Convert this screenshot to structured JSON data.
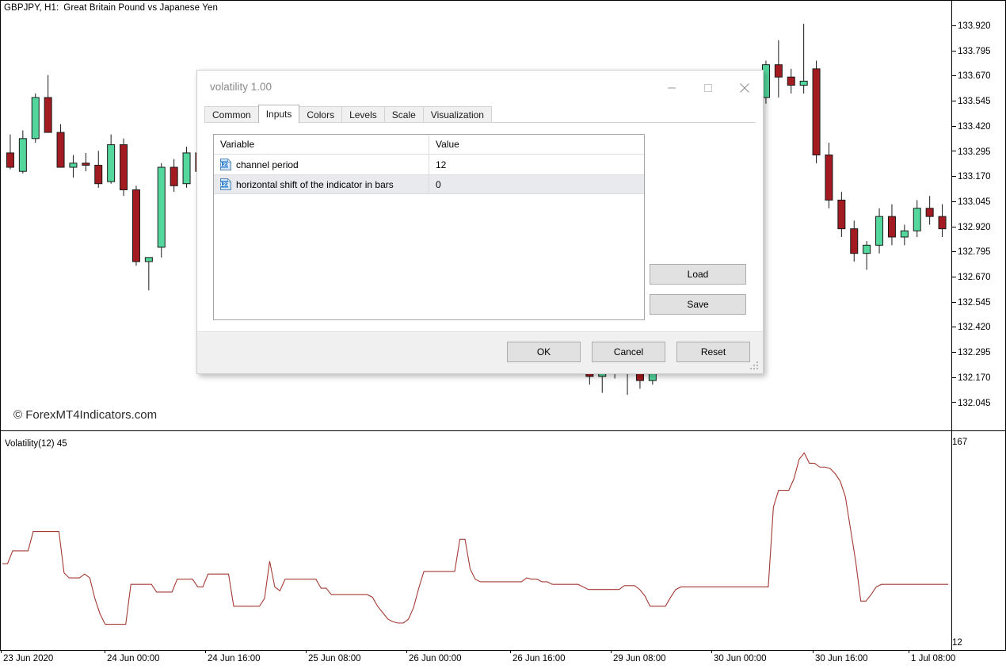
{
  "chart": {
    "symbol": "GBPJPY, H1:",
    "description": "Great Britain Pound vs Japanese Yen",
    "watermark": "© ForexMT4Indicators.com",
    "price_scale": [
      "133.920",
      "133.795",
      "133.670",
      "133.545",
      "133.420",
      "133.295",
      "133.170",
      "133.045",
      "132.920",
      "132.795",
      "132.670",
      "132.545",
      "132.420",
      "132.295",
      "132.170",
      "132.045"
    ],
    "time_labels": [
      "23 Jun 2020",
      "24 Jun 00:00",
      "24 Jun 16:00",
      "25 Jun 08:00",
      "26 Jun 00:00",
      "26 Jun 16:00",
      "29 Jun 08:00",
      "30 Jun 00:00",
      "30 Jun 16:00",
      "1 Jul 08:00"
    ],
    "indicator_label": "Volatility(12) 45",
    "indicator_scale_top": "167",
    "indicator_scale_bottom": "12",
    "colors": {
      "bull": "#53D79C",
      "bear": "#A31A20",
      "outline": "#1a1a1a",
      "indicator_line": "#A33A33",
      "axis": "#000000"
    }
  },
  "dialog": {
    "title": "volatility 1.00",
    "window_buttons": [
      {
        "name": "minimize-button",
        "icon": "minimize-icon"
      },
      {
        "name": "maximize-button",
        "icon": "maximize-icon"
      },
      {
        "name": "close-button",
        "icon": "close-icon"
      }
    ],
    "tabs": [
      {
        "label": "Common",
        "active": false
      },
      {
        "label": "Inputs",
        "active": true
      },
      {
        "label": "Colors",
        "active": false
      },
      {
        "label": "Levels",
        "active": false
      },
      {
        "label": "Scale",
        "active": false
      },
      {
        "label": "Visualization",
        "active": false
      }
    ],
    "table": {
      "headers": [
        "Variable",
        "Value"
      ],
      "rows": [
        {
          "icon": "123-number-icon",
          "variable": "channel period",
          "value": "12"
        },
        {
          "icon": "123-number-icon",
          "variable": "horizontal shift of the indicator in bars",
          "value": "0"
        }
      ]
    },
    "side_buttons": [
      {
        "label": "Load",
        "name": "load-button"
      },
      {
        "label": "Save",
        "name": "save-button"
      }
    ],
    "footer_buttons": [
      {
        "label": "OK",
        "name": "ok-button"
      },
      {
        "label": "Cancel",
        "name": "cancel-button"
      },
      {
        "label": "Reset",
        "name": "reset-button"
      }
    ]
  },
  "chart_data": {
    "type": "line",
    "title": "Volatility(12) 45",
    "xlabel": "",
    "ylabel": "",
    "ylim": [
      12,
      167
    ],
    "grid": false,
    "legend": "none",
    "x_tick_labels": [
      "23 Jun 2020",
      "24 Jun 00:00",
      "24 Jun 16:00",
      "25 Jun 08:00",
      "26 Jun 00:00",
      "26 Jun 16:00",
      "29 Jun 08:00",
      "30 Jun 00:00",
      "30 Jun 16:00",
      "1 Jul 08:00"
    ],
    "series": [
      {
        "name": "Volatility(12)",
        "color": "#A33A33",
        "values": [
          74,
          74,
          84,
          84,
          84,
          84,
          99,
          99,
          99,
          99,
          99,
          99,
          67,
          63,
          63,
          63,
          66,
          63,
          47,
          35,
          27,
          27,
          27,
          27,
          27,
          58,
          58,
          58,
          58,
          58,
          52,
          52,
          52,
          52,
          62,
          62,
          62,
          62,
          56,
          56,
          66,
          66,
          66,
          66,
          66,
          41,
          41,
          41,
          41,
          41,
          41,
          47,
          76,
          56,
          53,
          62,
          62,
          62,
          62,
          62,
          62,
          62,
          55,
          55,
          50,
          50,
          50,
          50,
          50,
          50,
          50,
          50,
          48,
          41,
          36,
          31,
          29,
          28,
          28,
          31,
          40,
          55,
          68,
          68,
          68,
          68,
          68,
          68,
          68,
          93,
          93,
          70,
          62,
          60,
          60,
          60,
          60,
          60,
          60,
          60,
          60,
          60,
          63,
          62,
          62,
          60,
          60,
          58,
          58,
          58,
          58,
          58,
          58,
          56,
          54,
          54,
          54,
          54,
          54,
          54,
          54,
          57,
          57,
          57,
          54,
          49,
          41,
          41,
          41,
          41,
          48,
          54,
          56,
          56,
          56,
          56,
          56,
          56,
          56,
          56,
          56,
          56,
          56,
          56,
          56,
          56,
          56,
          56,
          56,
          56,
          118,
          131,
          131,
          131,
          140,
          155,
          160,
          152,
          152,
          149,
          149,
          148,
          144,
          138,
          126,
          101,
          76,
          45,
          45,
          50,
          56,
          58,
          58,
          58,
          58,
          58,
          58,
          58,
          58,
          58,
          58,
          58,
          58,
          58,
          58
        ]
      }
    ]
  },
  "price_chart_data": {
    "type": "candlestick",
    "symbol": "GBPJPY",
    "timeframe": "H1",
    "y_tick_labels": [
      "133.920",
      "133.795",
      "133.670",
      "133.545",
      "133.420",
      "133.295",
      "133.170",
      "133.045",
      "132.920",
      "132.795",
      "132.670",
      "132.545",
      "132.420",
      "132.295",
      "132.170",
      "132.045"
    ],
    "ylim": [
      131.98,
      133.99
    ],
    "candles": [
      {
        "o": 133.31,
        "h": 133.4,
        "l": 133.23,
        "c": 133.24
      },
      {
        "o": 133.22,
        "h": 133.42,
        "l": 133.21,
        "c": 133.38
      },
      {
        "o": 133.38,
        "h": 133.6,
        "l": 133.36,
        "c": 133.58
      },
      {
        "o": 133.58,
        "h": 133.69,
        "l": 133.5,
        "c": 133.41
      },
      {
        "o": 133.41,
        "h": 133.45,
        "l": 133.31,
        "c": 133.24
      },
      {
        "o": 133.24,
        "h": 133.3,
        "l": 133.19,
        "c": 133.26
      },
      {
        "o": 133.26,
        "h": 133.31,
        "l": 133.22,
        "c": 133.25
      },
      {
        "o": 133.25,
        "h": 133.32,
        "l": 133.14,
        "c": 133.16
      },
      {
        "o": 133.17,
        "h": 133.4,
        "l": 133.16,
        "c": 133.35
      },
      {
        "o": 133.35,
        "h": 133.38,
        "l": 133.1,
        "c": 133.13
      },
      {
        "o": 133.13,
        "h": 133.15,
        "l": 132.76,
        "c": 132.78
      },
      {
        "o": 132.78,
        "h": 132.79,
        "l": 132.64,
        "c": 132.8
      },
      {
        "o": 132.85,
        "h": 133.26,
        "l": 132.8,
        "c": 133.24
      },
      {
        "o": 133.24,
        "h": 133.28,
        "l": 133.12,
        "c": 133.15
      },
      {
        "o": 133.16,
        "h": 133.34,
        "l": 133.14,
        "c": 133.31
      },
      {
        "o": 133.31,
        "h": 133.36,
        "l": 133.2,
        "c": 133.22
      },
      {
        "o": 133.22,
        "h": 133.26,
        "l": 133.17,
        "c": 133.24
      },
      {
        "o": 133.24,
        "h": 133.28,
        "l": 133.13,
        "c": 133.17
      },
      {
        "o": 133.17,
        "h": 133.3,
        "l": 133.16,
        "c": 133.28
      },
      {
        "o": 133.28,
        "h": 133.3,
        "l": 133.13,
        "c": 133.15
      },
      {
        "o": 133.15,
        "h": 133.22,
        "l": 133.13,
        "c": 133.2
      },
      {
        "o": 133.2,
        "h": 133.26,
        "l": 133.18,
        "c": 133.22
      },
      {
        "o": 133.22,
        "h": 133.56,
        "l": 133.2,
        "c": 133.53
      },
      {
        "o": 133.53,
        "h": 133.57,
        "l": 133.3,
        "c": 133.35
      },
      {
        "o": 133.35,
        "h": 133.38,
        "l": 133.25,
        "c": 133.27
      },
      {
        "o": 133.27,
        "h": 133.3,
        "l": 133.18,
        "c": 133.21
      },
      {
        "o": 133.21,
        "h": 133.34,
        "l": 133.16,
        "c": 133.24
      },
      {
        "o": 133.24,
        "h": 133.27,
        "l": 133.14,
        "c": 133.2
      },
      {
        "o": 133.22,
        "h": 133.36,
        "l": 133.17,
        "c": 133.33
      },
      {
        "o": 133.33,
        "h": 133.54,
        "l": 132.89,
        "c": 132.96
      },
      {
        "o": 132.96,
        "h": 133.0,
        "l": 132.86,
        "c": 132.93
      },
      {
        "o": 132.93,
        "h": 133.32,
        "l": 132.74,
        "c": 133.27
      },
      {
        "o": 133.27,
        "h": 133.32,
        "l": 133.07,
        "c": 133.11
      },
      {
        "o": 133.11,
        "h": 133.17,
        "l": 133.08,
        "c": 133.13
      },
      {
        "o": 133.13,
        "h": 133.18,
        "l": 133.01,
        "c": 133.05
      },
      {
        "o": 133.05,
        "h": 133.1,
        "l": 132.95,
        "c": 133.0
      },
      {
        "o": 133.0,
        "h": 133.05,
        "l": 132.9,
        "c": 132.95
      },
      {
        "o": 132.95,
        "h": 133.02,
        "l": 132.88,
        "c": 132.98
      },
      {
        "o": 132.98,
        "h": 133.03,
        "l": 132.85,
        "c": 132.9
      },
      {
        "o": 132.9,
        "h": 132.96,
        "l": 132.83,
        "c": 132.92
      },
      {
        "o": 132.92,
        "h": 132.98,
        "l": 132.82,
        "c": 132.87
      },
      {
        "o": 132.87,
        "h": 132.94,
        "l": 132.8,
        "c": 132.9
      },
      {
        "o": 132.9,
        "h": 132.95,
        "l": 132.78,
        "c": 132.82
      },
      {
        "o": 132.82,
        "h": 132.9,
        "l": 132.76,
        "c": 132.86
      },
      {
        "o": 132.86,
        "h": 132.92,
        "l": 132.74,
        "c": 132.8
      },
      {
        "o": 132.8,
        "h": 132.88,
        "l": 132.72,
        "c": 132.84
      },
      {
        "o": 132.28,
        "h": 132.46,
        "l": 132.18,
        "c": 132.22
      },
      {
        "o": 132.22,
        "h": 132.3,
        "l": 132.14,
        "c": 132.28
      },
      {
        "o": 132.28,
        "h": 132.36,
        "l": 132.21,
        "c": 132.24
      },
      {
        "o": 132.24,
        "h": 132.31,
        "l": 132.13,
        "c": 132.27
      },
      {
        "o": 132.27,
        "h": 132.3,
        "l": 132.16,
        "c": 132.2
      },
      {
        "o": 132.2,
        "h": 132.28,
        "l": 132.18,
        "c": 132.26
      },
      {
        "o": 132.26,
        "h": 132.45,
        "l": 132.24,
        "c": 132.42
      },
      {
        "o": 132.42,
        "h": 132.62,
        "l": 132.38,
        "c": 132.58
      },
      {
        "o": 132.58,
        "h": 133.1,
        "l": 132.55,
        "c": 133.07
      },
      {
        "o": 133.07,
        "h": 133.14,
        "l": 132.98,
        "c": 133.1
      },
      {
        "o": 133.1,
        "h": 133.28,
        "l": 133.05,
        "c": 133.26
      },
      {
        "o": 133.26,
        "h": 133.3,
        "l": 133.22,
        "c": 133.27
      },
      {
        "o": 133.27,
        "h": 133.64,
        "l": 133.24,
        "c": 133.62
      },
      {
        "o": 133.62,
        "h": 133.66,
        "l": 133.52,
        "c": 133.58
      },
      {
        "o": 133.58,
        "h": 133.76,
        "l": 133.55,
        "c": 133.74
      },
      {
        "o": 133.74,
        "h": 133.86,
        "l": 133.58,
        "c": 133.68
      },
      {
        "o": 133.68,
        "h": 133.72,
        "l": 133.6,
        "c": 133.64
      },
      {
        "o": 133.64,
        "h": 133.94,
        "l": 133.6,
        "c": 133.66
      },
      {
        "o": 133.72,
        "h": 133.76,
        "l": 133.26,
        "c": 133.3
      },
      {
        "o": 133.3,
        "h": 133.36,
        "l": 133.04,
        "c": 133.08
      },
      {
        "o": 133.08,
        "h": 133.12,
        "l": 132.9,
        "c": 132.94
      },
      {
        "o": 132.94,
        "h": 132.98,
        "l": 132.78,
        "c": 132.82
      },
      {
        "o": 132.82,
        "h": 132.88,
        "l": 132.74,
        "c": 132.86
      },
      {
        "o": 132.86,
        "h": 133.04,
        "l": 132.82,
        "c": 133.0
      },
      {
        "o": 133.0,
        "h": 133.06,
        "l": 132.86,
        "c": 132.9
      },
      {
        "o": 132.9,
        "h": 132.96,
        "l": 132.86,
        "c": 132.93
      },
      {
        "o": 132.93,
        "h": 133.08,
        "l": 132.9,
        "c": 133.04
      },
      {
        "o": 133.04,
        "h": 133.1,
        "l": 132.96,
        "c": 133.0
      },
      {
        "o": 133.0,
        "h": 133.06,
        "l": 132.9,
        "c": 132.94
      }
    ]
  }
}
